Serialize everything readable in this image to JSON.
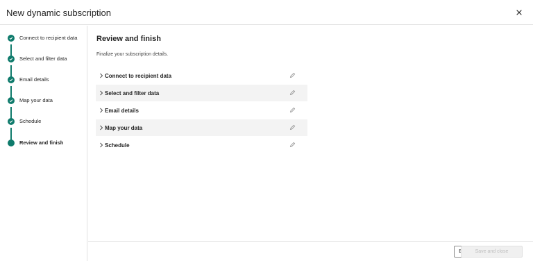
{
  "header": {
    "title": "New dynamic subscription"
  },
  "steps": [
    {
      "label": "Connect to recipient data",
      "status": "completed"
    },
    {
      "label": "Select and filter data",
      "status": "completed"
    },
    {
      "label": "Email details",
      "status": "completed"
    },
    {
      "label": "Map your data",
      "status": "completed"
    },
    {
      "label": "Schedule",
      "status": "completed"
    },
    {
      "label": "Review and finish",
      "status": "current"
    }
  ],
  "main": {
    "heading": "Review and finish",
    "description": "Finalize your subscription details.",
    "sections": [
      {
        "label": "Connect to recipient data"
      },
      {
        "label": "Select and filter data"
      },
      {
        "label": "Email details"
      },
      {
        "label": "Map your data"
      },
      {
        "label": "Schedule"
      }
    ]
  },
  "footer": {
    "back_label": "Back",
    "save_label": "Save and close"
  },
  "colors": {
    "accent": "#0f7b6c",
    "row_alt": "#f3f3f3",
    "disabled_bg": "#f0f0f0",
    "disabled_text": "#bdbdbd"
  },
  "icons": {
    "close": "close-icon",
    "check": "check-icon",
    "chevron": "chevron-right-icon",
    "edit": "pencil-icon"
  }
}
